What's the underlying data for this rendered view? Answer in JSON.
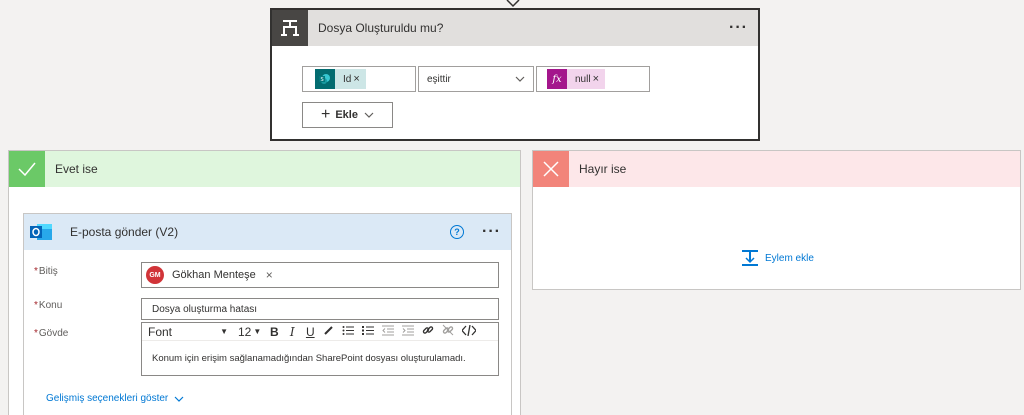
{
  "condition": {
    "title": "Dosya Oluşturuldu mu?",
    "more": "···",
    "left_token": "Id",
    "operator": "eşittir",
    "right_token": "null",
    "fx_symbol": "fx",
    "add_button": "Ekle",
    "remove": "×"
  },
  "yes_branch": {
    "title": "Evet ise",
    "email": {
      "title": "E-posta gönder (V2)",
      "help": "?",
      "more": "···",
      "to_label": "Bitiş",
      "to_person_initials": "GM",
      "to_person_name": "Gökhan Menteşe",
      "subject_label": "Konu",
      "subject_value": "Dosya oluşturma hatası",
      "body_label": "Gövde",
      "font_name": "Font",
      "font_size": "12",
      "body_value": "Konum için erişim sağlanamadığından SharePoint dosyası oluşturulamadı.",
      "advanced_link": "Gelişmiş seçenekleri göster",
      "required_mark": "*"
    }
  },
  "no_branch": {
    "title": "Hayır ise",
    "add_action": "Eylem ekle"
  },
  "colors": {
    "accent": "#0078d4",
    "yes_green": "#6bc967",
    "no_red": "#f2847a",
    "sharepoint": "#036c70",
    "expression": "#a4168c"
  }
}
